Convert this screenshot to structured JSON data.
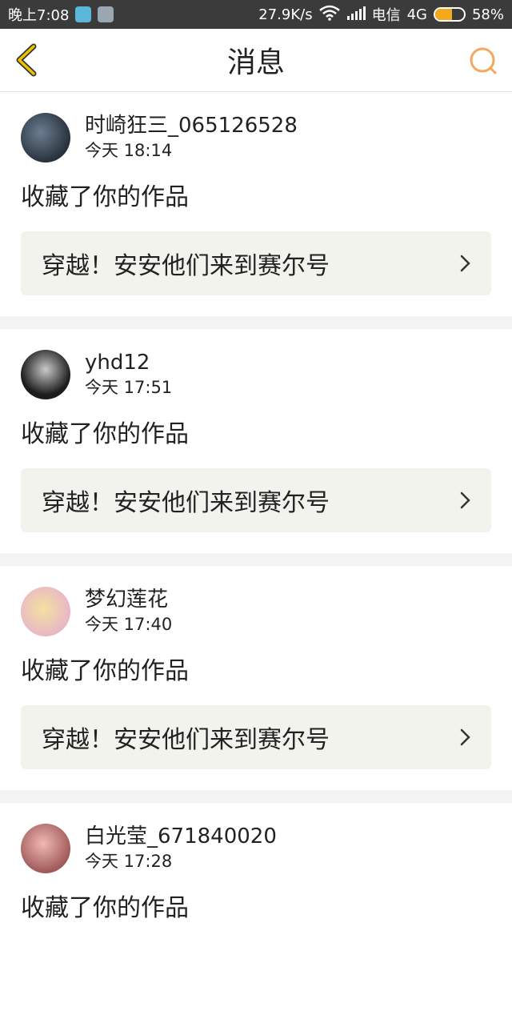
{
  "status_bar": {
    "time": "晚上7:08",
    "speed": "27.9K/s",
    "carrier": "电信",
    "network": "4G",
    "battery": "58%",
    "battery_level": 0.58,
    "icons": [
      "shield-app-icon",
      "doc-app-icon",
      "wifi-icon",
      "signal-icon",
      "battery-icon"
    ]
  },
  "header": {
    "title": "消息",
    "accent_color": "#f2a95d",
    "back_color": "#e9c400"
  },
  "messages": [
    {
      "name": "时崎狂三_065126528",
      "time": "今天 18:14",
      "action": "收藏了你的作品",
      "work_title": "穿越！安安他们来到赛尔号"
    },
    {
      "name": "yhd12",
      "time": "今天 17:51",
      "action": "收藏了你的作品",
      "work_title": "穿越！安安他们来到赛尔号"
    },
    {
      "name": "梦幻莲花",
      "time": "今天 17:40",
      "action": "收藏了你的作品",
      "work_title": "穿越！安安他们来到赛尔号"
    },
    {
      "name": "白光莹_671840020",
      "time": "今天 17:28",
      "action": "收藏了你的作品",
      "work_title": ""
    }
  ]
}
